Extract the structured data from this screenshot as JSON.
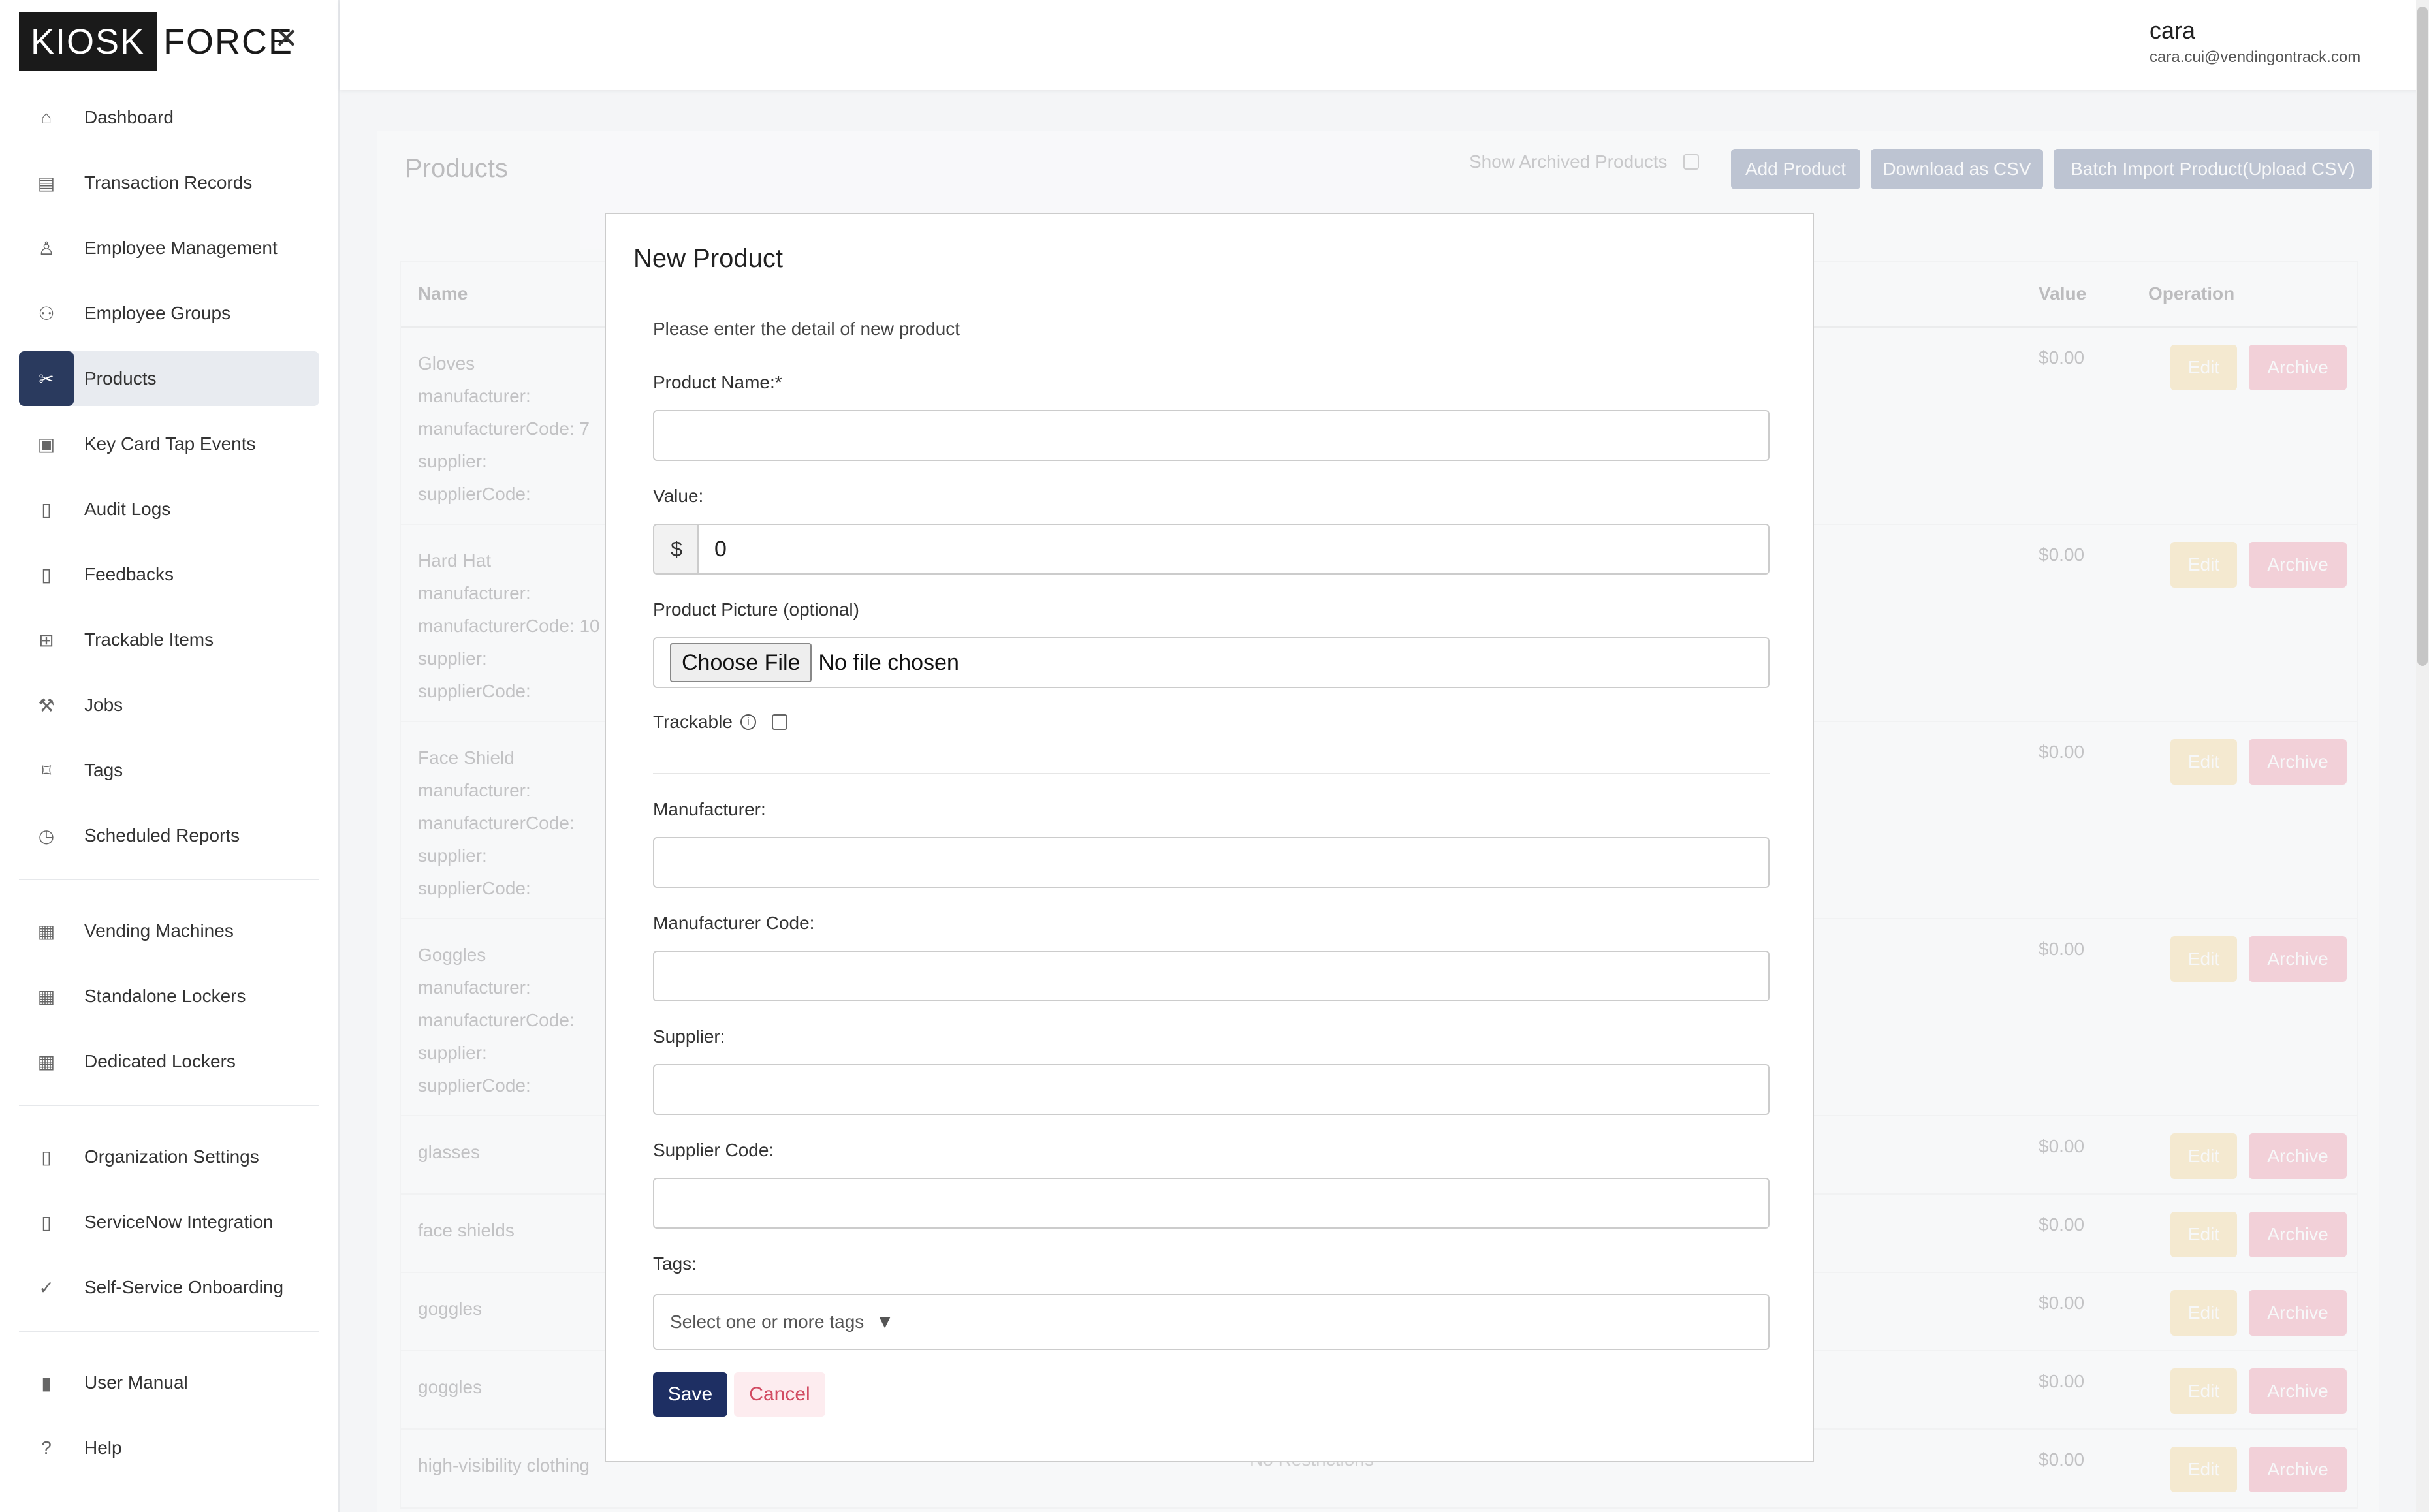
{
  "app": {
    "logo_left": "KIOSK",
    "logo_right": "FORCE"
  },
  "sidebar": {
    "items": [
      {
        "label": "Dashboard",
        "icon": "home-icon"
      },
      {
        "label": "Transaction Records",
        "icon": "receipt-icon"
      },
      {
        "label": "Employee Management",
        "icon": "user-icon"
      },
      {
        "label": "Employee Groups",
        "icon": "users-icon"
      },
      {
        "label": "Products",
        "icon": "tools-icon"
      },
      {
        "label": "Key Card Tap Events",
        "icon": "id-card-icon"
      },
      {
        "label": "Audit Logs",
        "icon": "document-icon"
      },
      {
        "label": "Feedbacks",
        "icon": "document-icon"
      },
      {
        "label": "Trackable Items",
        "icon": "sitemap-icon"
      },
      {
        "label": "Jobs",
        "icon": "hammer-icon"
      },
      {
        "label": "Tags",
        "icon": "tag-icon"
      },
      {
        "label": "Scheduled Reports",
        "icon": "clock-icon"
      },
      {
        "label": "Vending Machines",
        "icon": "grid-icon"
      },
      {
        "label": "Standalone Lockers",
        "icon": "table-icon"
      },
      {
        "label": "Dedicated Lockers",
        "icon": "table-icon"
      },
      {
        "label": "Organization Settings",
        "icon": "document-icon"
      },
      {
        "label": "ServiceNow Integration",
        "icon": "document-icon"
      },
      {
        "label": "Self-Service Onboarding",
        "icon": "check-circle-icon"
      },
      {
        "label": "User Manual",
        "icon": "book-icon"
      },
      {
        "label": "Help",
        "icon": "question-icon"
      }
    ]
  },
  "header": {
    "user_name": "cara",
    "user_email": "cara.cui@vendingontrack.com"
  },
  "page": {
    "title": "Products",
    "show_archived_label": "Show Archived Products",
    "add_product": "Add Product",
    "download_csv": "Download as CSV",
    "batch_import": "Batch Import Product(Upload CSV)",
    "columns": {
      "name": "Name",
      "value": "Value",
      "operation": "Operation"
    },
    "edit_label": "Edit",
    "archive_label": "Archive",
    "rows": [
      {
        "lines": [
          "Gloves",
          "manufacturer:",
          "manufacturerCode: 7",
          "supplier:",
          "supplierCode:"
        ],
        "value": "$0.00"
      },
      {
        "lines": [
          "Hard Hat",
          "manufacturer:",
          "manufacturerCode: 10",
          "supplier:",
          "supplierCode:"
        ],
        "value": "$0.00"
      },
      {
        "lines": [
          "Face Shield",
          "manufacturer:",
          "manufacturerCode:",
          "supplier:",
          "supplierCode:"
        ],
        "value": "$0.00"
      },
      {
        "lines": [
          "Goggles",
          "manufacturer:",
          "manufacturerCode:",
          "supplier:",
          "supplierCode:"
        ],
        "value": "$0.00"
      },
      {
        "lines": [
          "glasses"
        ],
        "value": "$0.00"
      },
      {
        "lines": [
          "face shields"
        ],
        "value": "$0.00"
      },
      {
        "lines": [
          "goggles"
        ],
        "value": "$0.00"
      },
      {
        "lines": [
          "goggles"
        ],
        "value": "$0.00"
      },
      {
        "lines": [
          "high-visibility clothing"
        ],
        "value": "$0.00",
        "restriction": "No Restrictions"
      }
    ]
  },
  "modal": {
    "title": "New Product",
    "subtitle": "Please enter the detail of new product",
    "product_name_label": "Product Name:*",
    "product_name_value": "",
    "value_label": "Value:",
    "value_prefix": "$",
    "value_value": "0",
    "picture_label": "Product Picture (optional)",
    "choose_file": "Choose File",
    "file_status": "No file chosen",
    "trackable_label": "Trackable",
    "info_glyph": "i",
    "manufacturer_label": "Manufacturer:",
    "manufacturer_code_label": "Manufacturer Code:",
    "supplier_label": "Supplier:",
    "supplier_code_label": "Supplier Code:",
    "tags_label": "Tags:",
    "tags_placeholder": "Select one or more tags",
    "tags_caret": "▼",
    "save": "Save",
    "cancel": "Cancel"
  }
}
